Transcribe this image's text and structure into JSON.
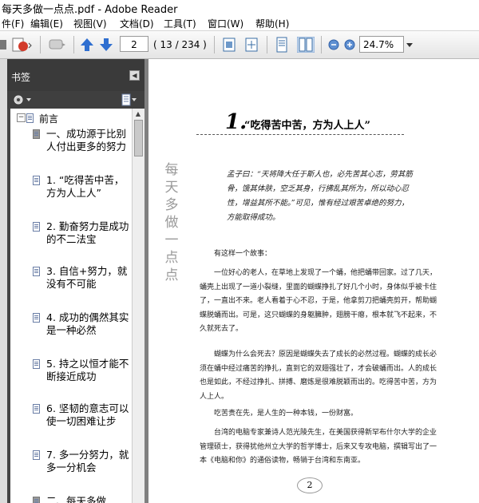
{
  "window": {
    "title": "每天多做一点点.pdf - Adobe Reader"
  },
  "menu": [
    "件(F)",
    "编辑(E)",
    "视图(V)",
    "文档(D)",
    "工具(T)",
    "窗口(W)",
    "帮助(H)"
  ],
  "toolbar": {
    "page_value": "2",
    "page_count": "( 13 / 234 )",
    "zoom": "24.7%"
  },
  "panel": {
    "title": "书签"
  },
  "bookmarks": {
    "root": "前言",
    "items": [
      {
        "label": "一、成功源于比别人付出更多的努力"
      },
      {
        "label": "1. “吃得苦中苦，方为人上人”"
      },
      {
        "label": "2. 勤奋努力是成功的不二法宝"
      },
      {
        "label": "3. 自信+努力，就没有不可能"
      },
      {
        "label": "4. 成功的偶然其实是一种必然"
      },
      {
        "label": "5. 持之以恒才能不断接近成功"
      },
      {
        "label": "6. 坚韧的意志可以使一切困难让步"
      },
      {
        "label": "7. 多一分努力，就多一分机会"
      },
      {
        "label": "二、每天多做"
      }
    ]
  },
  "document": {
    "chapter_number": "1.",
    "chapter_title": "“吃得苦中苦，方为人上人”",
    "side_title": "每天多做一点点",
    "quote": "孟子曰：“天将降大任于斯人也，必先苦其心志，劳其筋骨，饿其体肤，空乏其身，行拂乱其所为，所以动心忍性，增益其所不能。”可见，惟有经过艰苦卓绝的努力，方能取得成功。",
    "paragraphs": [
      "有这样一个故事：",
      "一位好心的老人，在草地上发现了一个蛹，他把蛹带回家。过了几天，蛹壳上出现了一道小裂缝，里面的蝴蝶挣扎了好几个小时，身体似乎被卡住了，一直出不来。老人看着于心不忍，于是，他拿剪刀把蛹壳剪开，帮助蝴蝶脱蛹而出。可是，这只蝴蝶的身躯臃肿，翅膀干瘪，根本就飞不起来，不久就死去了。",
      "蝴蝶为什么会死去？原因是蝴蝶失去了成长的必然过程。蝴蝶的成长必须在蛹中经过痛苦的挣扎，直到它的双翅强壮了，才会破蛹而出。人的成长也是如此，不经过挣扎、拼搏、磨炼是很难脱颖而出的。吃得苦中苦，方为人上人。",
      "吃苦贵在先，是人生的一种本钱，一份财富。",
      "台湾的电脑专家兼诗人范光陵先生，在美国获得新罕布什尔大学的企业管理硕士，获得犹他州立大学的哲学博士，后来又专攻电脑，撰辑写出了一本《电脑和你》的通俗读物，畅销于台湾和东南亚。"
    ],
    "page_number": "2"
  },
  "colors": {
    "panel_bg": "#444444",
    "viewer_bg": "#808080",
    "nav_arrow": "#2f6fd0"
  }
}
